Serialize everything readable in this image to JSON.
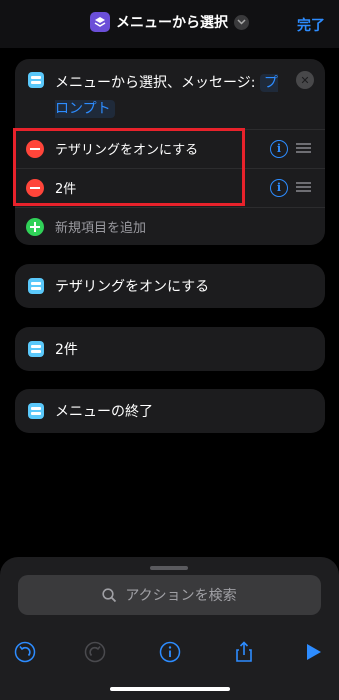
{
  "header": {
    "title": "メニューから選択",
    "done_label": "完了"
  },
  "menu": {
    "title_prefix": "メニューから選択、メッセージ: ",
    "prompt_label": "プロンプト",
    "items": [
      {
        "label": "テザリングをオンにする"
      },
      {
        "label": "2件"
      }
    ],
    "add_label": "新規項目を追加"
  },
  "actions": [
    {
      "label": "テザリングをオンにする"
    },
    {
      "label": "2件"
    },
    {
      "label": "メニューの終了"
    }
  ],
  "search": {
    "placeholder": "アクションを検索"
  },
  "toolbar": {
    "icons": [
      "undo-icon",
      "redo-icon",
      "info-icon",
      "share-icon",
      "play-icon"
    ]
  },
  "colors": {
    "accent": "#2d8cff",
    "highlight": "#e8222b",
    "remove": "#ff453a",
    "add": "#30d158"
  }
}
